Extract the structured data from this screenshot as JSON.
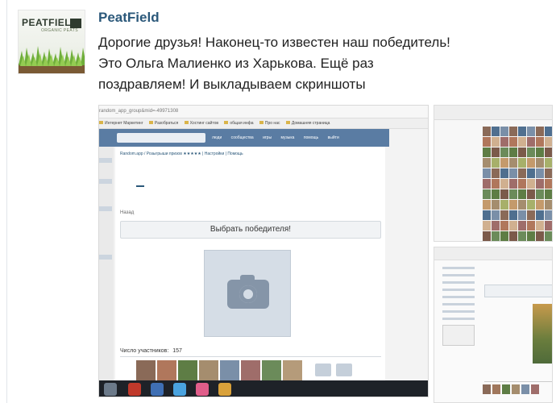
{
  "post": {
    "author": "PeatField",
    "avatar_logo": "PEATFIELD",
    "avatar_sub": "ORGANIC PEATS",
    "text_lines": [
      "Дорогие друзья! Наконец-то известен наш победитель!",
      "Это Ольга Малиенко из Харькова. Ещё раз",
      "поздравляем! И выкладываем скриншоты"
    ]
  },
  "screenshot": {
    "url": "random_app_group&mid=-49971308",
    "bookmarks": [
      "Интернет Маркетинг",
      "Разобраться",
      "Хостинг сайтов",
      "общая инфа",
      "Про нас",
      "Домашняя страница"
    ],
    "vk_nav": [
      "люди",
      "сообщества",
      "игры",
      "музыка",
      "помощь",
      "выйти"
    ],
    "breadcrumb": "Random.app / Розыгрыши призов ★★★★★ | Настройки | Помощь",
    "back_label": "Назад",
    "choose_button": "Выбрать победителя!",
    "participants_label": "Число участников:",
    "participants_count": "157"
  },
  "colors": {
    "link": "#2b587a",
    "vk_header": "#5a7ca3",
    "taskbar": "#1e2228"
  },
  "icons": [
    "camera-icon",
    "camera-icon",
    "camera-icon"
  ]
}
